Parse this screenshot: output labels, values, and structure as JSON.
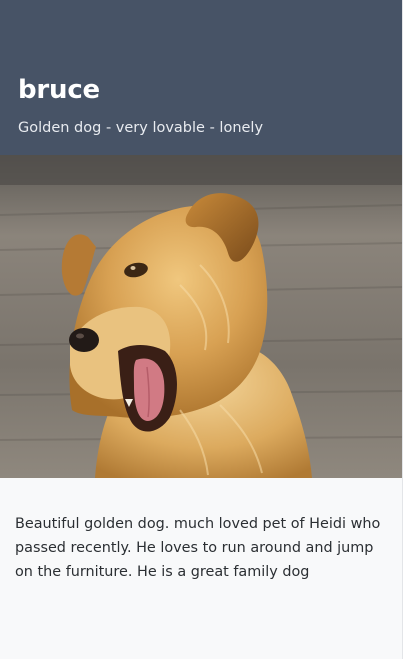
{
  "card": {
    "title": "bruce",
    "subtitle": "Golden dog - very lovable - lonely",
    "image": {
      "alt": "Golden dog"
    },
    "description": "Beautiful golden dog. much loved pet of Heidi who passed recently. He loves to run around and jump on the furniture. He is a great family dog"
  },
  "colors": {
    "header_background": "#475366",
    "header_text": "#ffffff",
    "body_background": "#f8f9fa",
    "body_text": "#2b2f33"
  }
}
